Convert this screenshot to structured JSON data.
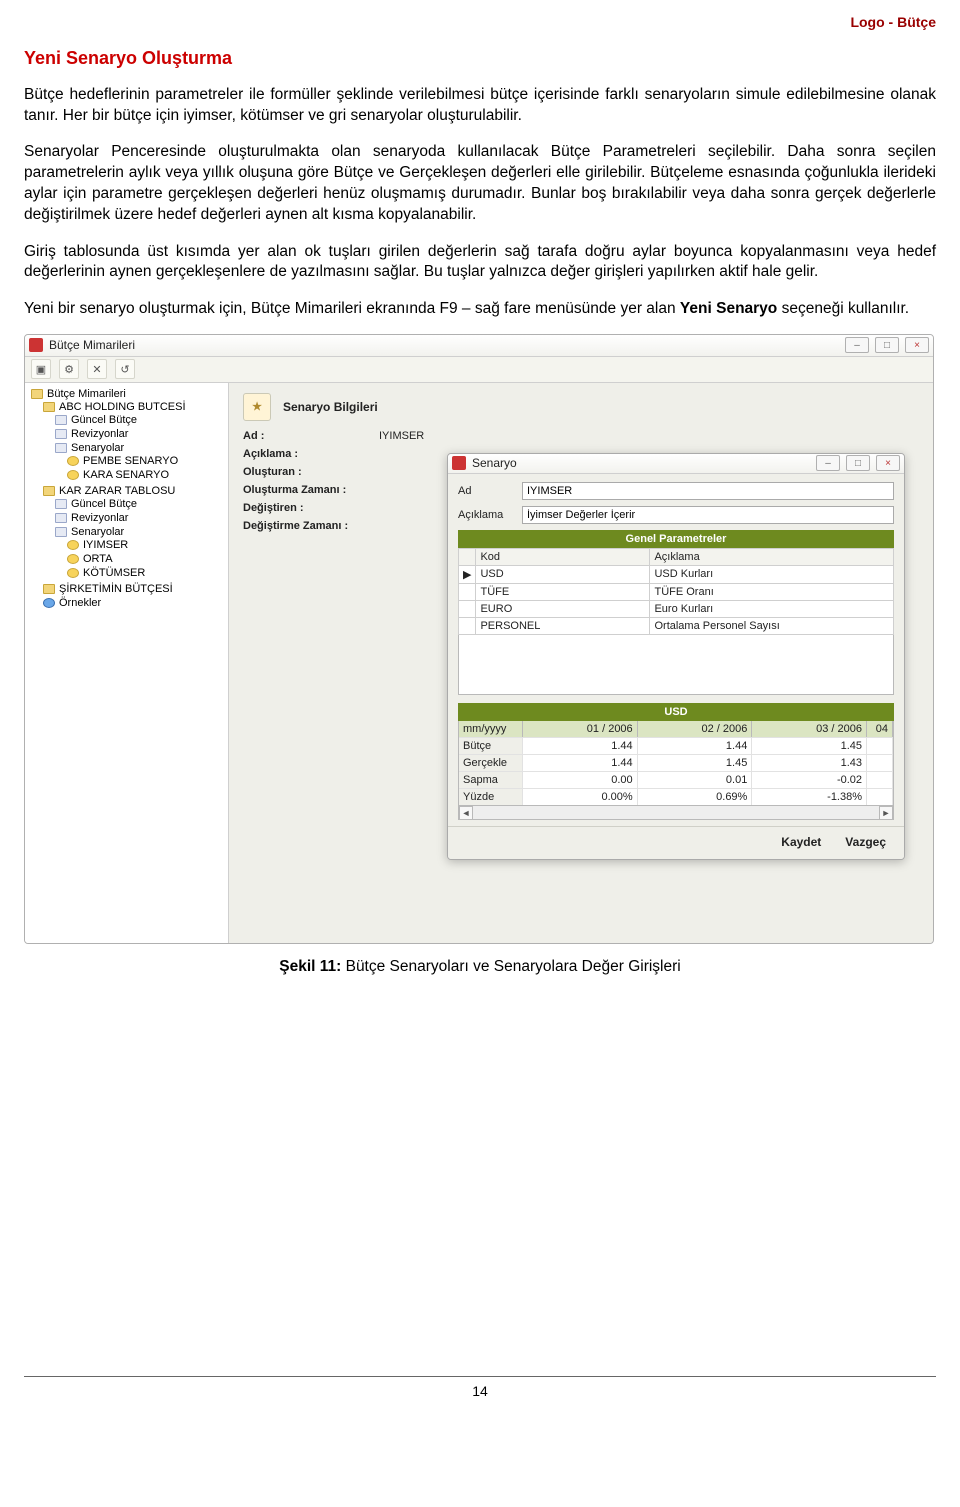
{
  "page_header": "Logo - Bütçe",
  "title": "Yeni Senaryo Oluşturma",
  "paragraphs": {
    "p1": "Bütçe hedeflerinin parametreler ile formüller şeklinde verilebilmesi bütçe içerisinde farklı senaryoların simule edilebilmesine olanak tanır. Her bir bütçe için iyimser, kötümser ve gri senaryolar oluşturulabilir.",
    "p2": "Senaryolar Penceresinde oluşturulmakta olan senaryoda kullanılacak Bütçe Parametreleri seçilebilir. Daha sonra seçilen parametrelerin aylık veya yıllık oluşuna göre Bütçe ve Gerçekleşen değerleri elle girilebilir. Bütçeleme esnasında çoğunlukla ilerideki aylar için parametre gerçekleşen değerleri henüz oluşmamış durumadır. Bunlar boş bırakılabilir veya daha sonra gerçek değerlerle değiştirilmek üzere hedef değerleri aynen alt kısma kopyalanabilir.",
    "p3": "Giriş tablosunda üst kısımda yer alan ok tuşları girilen değerlerin sağ tarafa doğru aylar boyunca kopyalanmasını veya hedef değerlerinin aynen gerçekleşenlere de yazılmasını sağlar. Bu tuşlar yalnızca değer girişleri yapılırken aktif hale gelir.",
    "p4_pre": "Yeni bir senaryo oluşturmak için, Bütçe Mimarileri ekranında F9 – sağ fare menüsünde yer alan ",
    "p4_bold": "Yeni Senaryo",
    "p4_post": " seçeneği kullanılır."
  },
  "caption": {
    "label": "Şekil 11:",
    "text": " Bütçe Senaryoları ve Senaryolara Değer Girişleri"
  },
  "page_number": "14",
  "app": {
    "title": "Bütçe Mimarileri",
    "tree": {
      "root": "Bütçe Mimarileri",
      "items": [
        {
          "label": "ABC HOLDING BUTCESİ",
          "children": [
            {
              "label": "Güncel Bütçe"
            },
            {
              "label": "Revizyonlar"
            },
            {
              "label": "Senaryolar",
              "children": [
                {
                  "label": "PEMBE SENARYO"
                },
                {
                  "label": "KARA SENARYO"
                }
              ]
            }
          ]
        },
        {
          "label": "KAR ZARAR TABLOSU",
          "children": [
            {
              "label": "Güncel Bütçe"
            },
            {
              "label": "Revizyonlar"
            },
            {
              "label": "Senaryolar",
              "children": [
                {
                  "label": "IYIMSER"
                },
                {
                  "label": "ORTA"
                },
                {
                  "label": "KÖTÜMSER"
                }
              ]
            }
          ]
        },
        {
          "label": "ŞİRKETİMİN BÜTÇESİ"
        },
        {
          "label": "Örnekler"
        }
      ]
    },
    "info": {
      "panel_title": "Senaryo Bilgileri",
      "ad_label": "Ad :",
      "ad_value": "IYIMSER",
      "aciklama_label": "Açıklama :",
      "olusturan_label": "Oluşturan :",
      "olusturma_label": "Oluşturma Zamanı :",
      "degistiren_label": "Değiştiren :",
      "degistirme_label": "Değiştirme Zamanı :"
    },
    "scenario": {
      "window_title": "Senaryo",
      "ad_label": "Ad",
      "ad_value": "IYIMSER",
      "aciklama_label": "Açıklama",
      "aciklama_value": "İyimser Değerler İçerir",
      "grid_title": "Genel Parametreler",
      "col_kod": "Kod",
      "col_aciklama": "Açıklama",
      "rows": [
        {
          "kod": "USD",
          "aciklama": "USD Kurları"
        },
        {
          "kod": "TÜFE",
          "aciklama": "TÜFE Oranı"
        },
        {
          "kod": "EURO",
          "aciklama": "Euro Kurları"
        },
        {
          "kod": "PERSONEL",
          "aciklama": "Ortalama Personel Sayısı"
        }
      ],
      "usd_title": "USD",
      "months_label": "mm/yyyy",
      "months": [
        "01 / 2006",
        "02 / 2006",
        "03 / 2006",
        "04"
      ],
      "data_rows": [
        {
          "label": "Bütçe",
          "v": [
            "1.44",
            "1.44",
            "1.45"
          ]
        },
        {
          "label": "Gerçekle",
          "v": [
            "1.44",
            "1.45",
            "1.43"
          ]
        },
        {
          "label": "Sapma",
          "v": [
            "0.00",
            "0.01",
            "-0.02"
          ]
        },
        {
          "label": "Yüzde",
          "v": [
            "0.00%",
            "0.69%",
            "-1.38%"
          ]
        }
      ],
      "save_label": "Kaydet",
      "cancel_label": "Vazgeç"
    }
  }
}
